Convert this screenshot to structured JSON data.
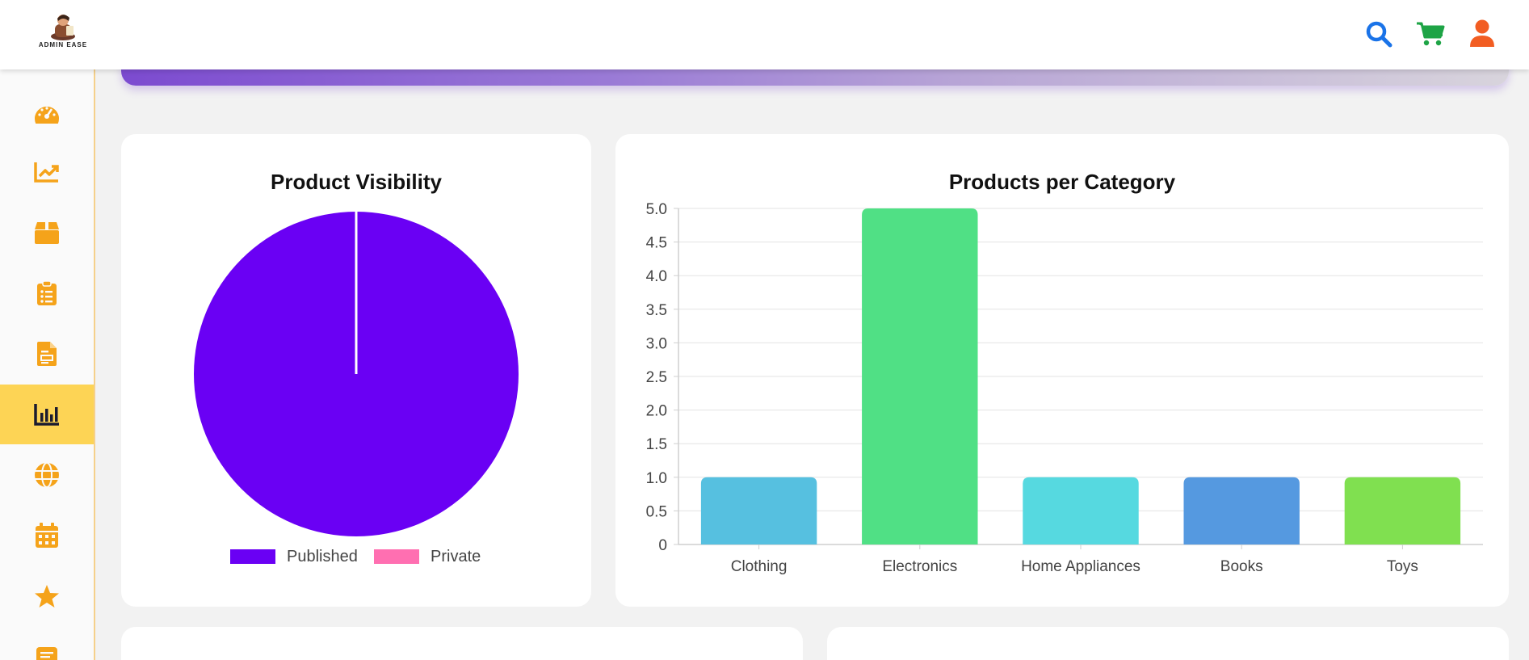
{
  "app": {
    "logo_text": "ADMIN EASE"
  },
  "header": {
    "icons": [
      {
        "name": "search-icon",
        "color": "#1a73e8"
      },
      {
        "name": "cart-icon",
        "color": "#1ea446"
      },
      {
        "name": "user-icon",
        "color": "#f25d22"
      }
    ]
  },
  "sidebar": {
    "accent": "#f5a31a",
    "active_bg": "#fdd455",
    "items": [
      {
        "icon": "dashboard-gauge-icon",
        "active": false
      },
      {
        "icon": "trend-chart-icon",
        "active": false
      },
      {
        "icon": "box-icon",
        "active": false
      },
      {
        "icon": "clipboard-list-icon",
        "active": false
      },
      {
        "icon": "document-icon",
        "active": false
      },
      {
        "icon": "bar-chart-icon",
        "active": true
      },
      {
        "icon": "globe-icon",
        "active": false
      },
      {
        "icon": "calendar-icon",
        "active": false
      },
      {
        "icon": "star-icon",
        "active": false
      },
      {
        "icon": "notes-icon",
        "active": false
      }
    ]
  },
  "charts": {
    "visibility_title": "Product Visibility",
    "category_title": "Products per Category"
  },
  "chart_data": [
    {
      "type": "pie",
      "title": "Product Visibility",
      "categories": [
        "Published",
        "Private"
      ],
      "values": [
        7,
        0
      ],
      "colors": [
        "#6a00f4",
        "#ff6fb1"
      ],
      "legend": "bottom"
    },
    {
      "type": "bar",
      "title": "Products per Category",
      "categories": [
        "Clothing",
        "Electronics",
        "Home Appliances",
        "Books",
        "Toys"
      ],
      "values": [
        1,
        5,
        1,
        1,
        1
      ],
      "colors": [
        "#56c0e0",
        "#50e085",
        "#56d9e0",
        "#5599e0",
        "#80e050"
      ],
      "ylim": [
        0,
        5
      ],
      "yticks": [
        "0",
        "0.5",
        "1.0",
        "1.5",
        "2.0",
        "2.5",
        "3.0",
        "3.5",
        "4.0",
        "4.5",
        "5.0"
      ],
      "xlabel": "",
      "ylabel": "",
      "grid": true
    }
  ]
}
